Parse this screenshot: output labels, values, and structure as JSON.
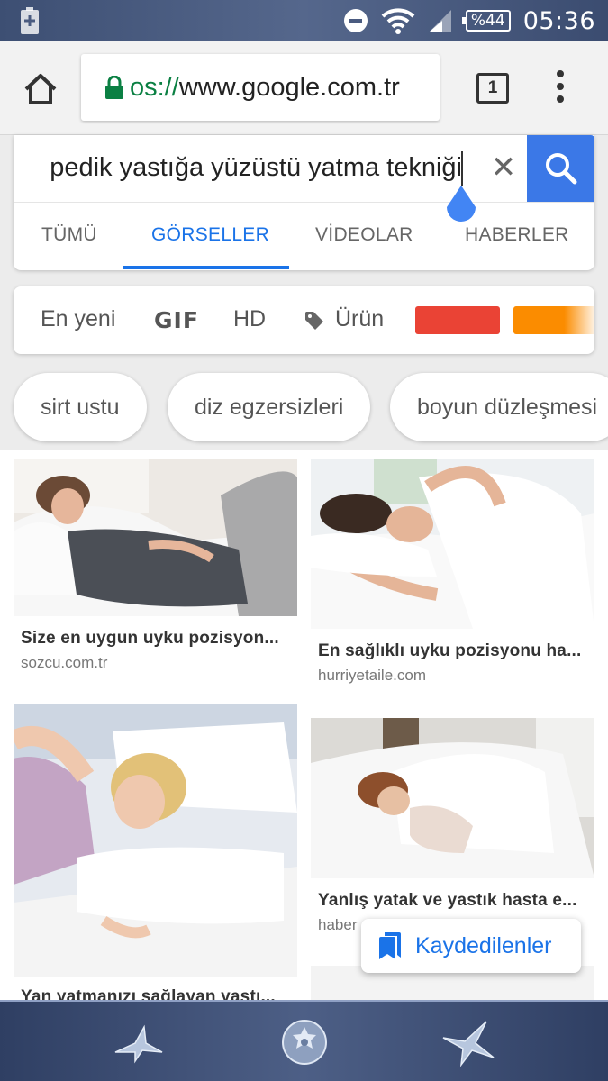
{
  "status": {
    "battery": "%44",
    "time": "05:36"
  },
  "browser": {
    "url_scheme": "os://",
    "url_host": "www.google.com.tr",
    "tab_count": "1"
  },
  "search": {
    "query": "pedik yastığa yüzüstü yatma tekniği",
    "tabs": [
      {
        "label": "TÜMÜ"
      },
      {
        "label": "GÖRSELLER"
      },
      {
        "label": "VİDEOLAR"
      },
      {
        "label": "HABERLER"
      }
    ],
    "active_tab": "GÖRSELLER"
  },
  "filters": {
    "newest": "En yeni",
    "gif": "GIF",
    "hd": "HD",
    "product": "Ürün",
    "colors": [
      "#ea4335",
      "#fb8c00"
    ]
  },
  "chips": [
    "sirt ustu",
    "diz egzersizleri",
    "boyun düzleşmesi"
  ],
  "results": [
    {
      "title": "Size en uygun uyku pozisyon...",
      "source": "sozcu.com.tr"
    },
    {
      "title": "En sağlıklı uyku pozisyonu ha...",
      "source": "hurriyetaile.com"
    },
    {
      "title": "Yan yatmanızı sağlayan yastı...",
      "source": ""
    },
    {
      "title": "Yanlış yatak ve yastık hasta e...",
      "source": "haber"
    }
  ],
  "saved": {
    "label": "Kaydedilenler"
  },
  "colors": {
    "accent": "#1a73e8",
    "search_button": "#3b78e7",
    "secure": "#0b8043"
  }
}
